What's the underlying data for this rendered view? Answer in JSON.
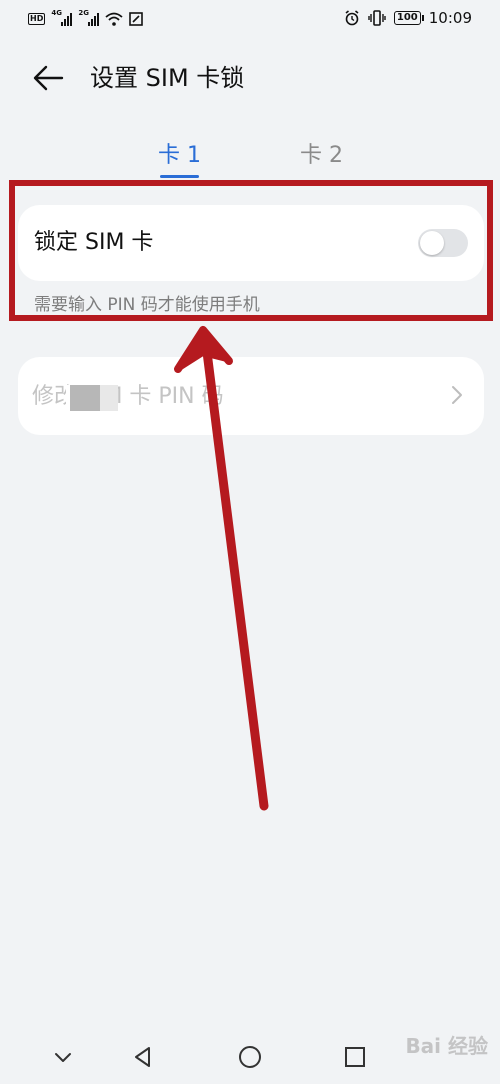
{
  "status_bar": {
    "hd_label": "HD",
    "sim1_network": "4G",
    "sim2_network": "2G",
    "battery": "100",
    "time": "10:09"
  },
  "header": {
    "title": "设置 SIM 卡锁",
    "back_icon": "arrow-left-icon"
  },
  "tabs": [
    {
      "label": "卡 1",
      "active": true
    },
    {
      "label": "卡 2",
      "active": false
    }
  ],
  "lock_card": {
    "label": "锁定 SIM 卡",
    "toggle_on": false,
    "description": "需要输入 PIN 码才能使用手机"
  },
  "change_card": {
    "label": "修改 SIM 卡 PIN 码"
  },
  "colors": {
    "accent": "#2a6dd6",
    "background": "#f1f3f5",
    "card": "#ffffff",
    "annotation": "#b51a1f"
  },
  "watermark": "Bai 经验"
}
